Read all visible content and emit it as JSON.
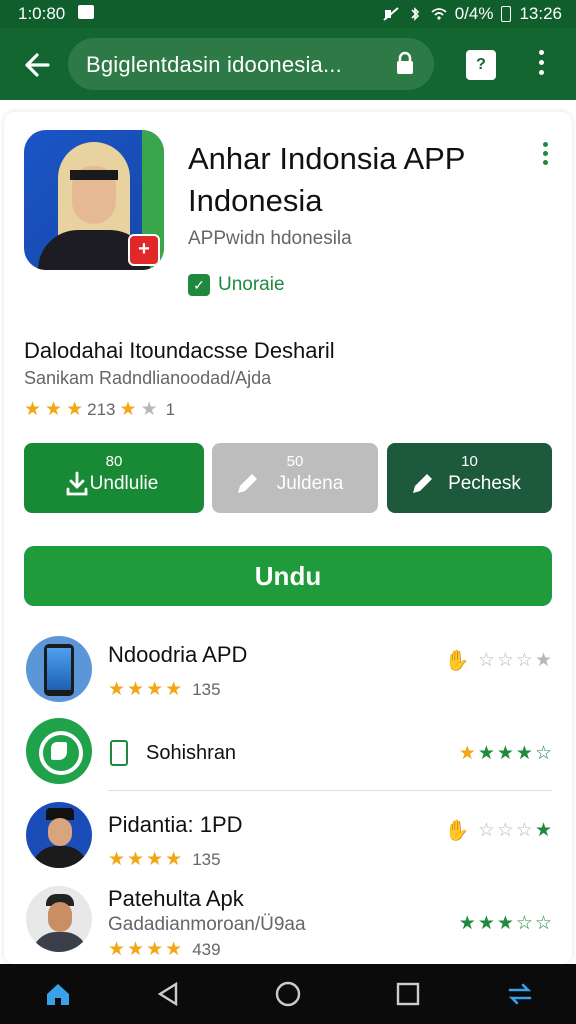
{
  "status_bar": {
    "time": "1:0:80",
    "battery": "0/4%",
    "clock": "13:26"
  },
  "browser": {
    "url_text": "Bgiglentdasin idoonesia...",
    "tab_count": "?"
  },
  "app": {
    "title": "Anhar Indonsia APP Indonesia",
    "subtitle": "APPwidn hdonesila",
    "install_label": "Unoraie"
  },
  "section": {
    "title": "Dalodahai Itoundacsse Desharil",
    "subtitle": "Sanikam Radndlianoodad/Ajda",
    "rating_text": "213",
    "rating_extra": "1",
    "stars_filled": 3
  },
  "actions": [
    {
      "count": "80",
      "label": "Undlulie",
      "icon": "download-icon"
    },
    {
      "count": "50",
      "label": "Juldena",
      "icon": "pencil-icon"
    },
    {
      "count": "10",
      "label": "Pechesk",
      "icon": "pencil-icon"
    }
  ],
  "primary_button": "Undu",
  "list": [
    {
      "name": "Ndoodria APD",
      "count": "135",
      "stars": 4,
      "right_type": "thumb-stars",
      "right_stars": 3
    },
    {
      "name": "Sohishran",
      "right_type": "stars",
      "right_stars": 4
    },
    {
      "name": "Pidantia: 1PD",
      "count": "135",
      "stars": 4,
      "right_type": "thumb-stars",
      "right_stars": 3
    },
    {
      "name": "Patehulta Apk",
      "sub": "Gadadianmoroan/Ü9aa",
      "count": "439",
      "stars": 4,
      "right_type": "stars",
      "right_stars": 3
    }
  ],
  "colors": {
    "brand_green": "#13662f",
    "button_green": "#1f9b3c",
    "star": "#f3a716"
  }
}
